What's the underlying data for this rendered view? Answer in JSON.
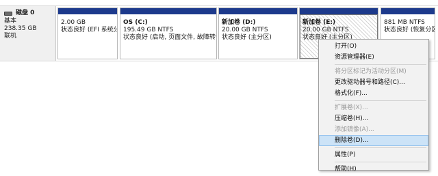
{
  "disk": {
    "name": "磁盘 0",
    "type": "基本",
    "size": "238.35 GB",
    "status": "联机"
  },
  "partitions": [
    {
      "name": "",
      "size": "2.00 GB",
      "status": "状态良好 (EFI 系统分"
    },
    {
      "name": "OS  (C:)",
      "size": "195.49 GB NTFS",
      "status": "状态良好 (启动, 页面文件, 故障转储"
    },
    {
      "name": "新加卷  (D:)",
      "size": "20.00 GB NTFS",
      "status": "状态良好 (主分区)"
    },
    {
      "name": "新加卷  (E:)",
      "size": "20.00 GB NTFS",
      "status": "状态良好 (主分区)"
    },
    {
      "name": "",
      "size": "881 MB NTFS",
      "status": "状态良好 (恢复分区)"
    }
  ],
  "menu": {
    "groups": [
      [
        {
          "label": "打开(O)",
          "enabled": true
        },
        {
          "label": "资源管理器(E)",
          "enabled": true
        }
      ],
      [
        {
          "label": "将分区标记为活动分区(M)",
          "enabled": false
        },
        {
          "label": "更改驱动器号和路径(C)...",
          "enabled": true
        },
        {
          "label": "格式化(F)...",
          "enabled": true
        }
      ],
      [
        {
          "label": "扩展卷(X)...",
          "enabled": false
        },
        {
          "label": "压缩卷(H)...",
          "enabled": true
        },
        {
          "label": "添加镜像(A)...",
          "enabled": false
        },
        {
          "label": "删除卷(D)...",
          "enabled": true,
          "highlighted": true
        }
      ],
      [
        {
          "label": "属性(P)",
          "enabled": true
        }
      ],
      [
        {
          "label": "帮助(H)",
          "enabled": true
        }
      ]
    ]
  },
  "colors": {
    "partition_header": "#1d3a8c",
    "menu_highlight": "#cce3f7",
    "disabled_text": "#9a9a9a"
  }
}
